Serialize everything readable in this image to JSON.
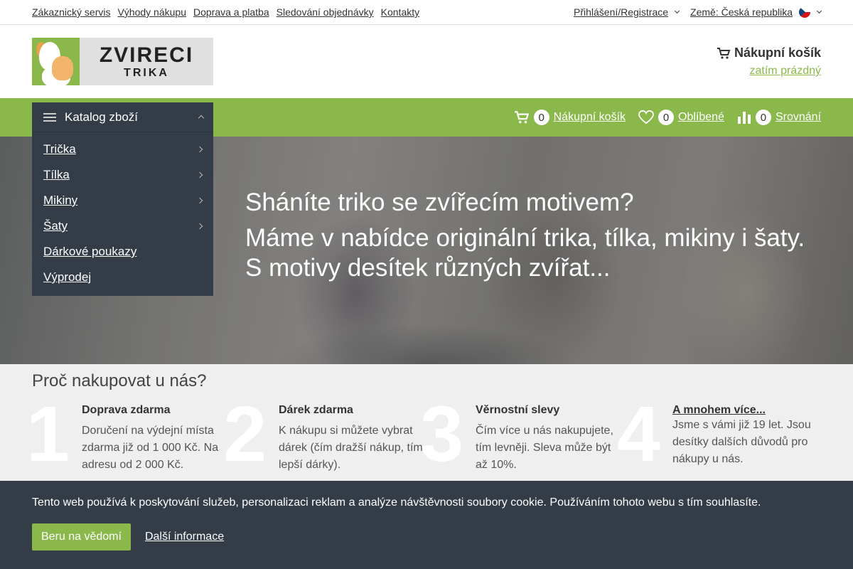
{
  "topbar": {
    "links": [
      "Zákaznický servis",
      "Výhody nákupu",
      "Doprava a platba",
      "Sledování objednávky",
      "Kontakty"
    ],
    "login": "Přihlášení/Registrace",
    "country": "Země: Česká republika"
  },
  "header": {
    "logo_line1": "ZVIRECI",
    "logo_line2": "TRIKA",
    "cart_title": "Nákupní košík",
    "cart_status": "zatím prázdný"
  },
  "nav": {
    "cart_count": "0",
    "cart_label": "Nákupní košík",
    "fav_count": "0",
    "fav_label": "Oblíbené",
    "compare_count": "0",
    "compare_label": "Srovnání"
  },
  "catalog": {
    "title": "Katalog zboží",
    "items": [
      "Trička",
      "Tílka",
      "Mikiny",
      "Šaty",
      "Dárkové poukazy",
      "Výprodej"
    ]
  },
  "hero": {
    "line1": "Sháníte triko se zvířecím motivem?",
    "line2": "Máme v nabídce originální trika, tílka, mikiny i šaty.",
    "line3": "S motivy desítek různých zvířat..."
  },
  "why": {
    "title": "Proč nakupovat u nás?",
    "benefits": [
      {
        "num": "1",
        "title": "Doprava zdarma",
        "text": "Doručení na výdejní místa zdarma již od 1 000 Kč. Na adresu od 2 000 Kč."
      },
      {
        "num": "2",
        "title": "Dárek zdarma",
        "text": "K nákupu si můžete vybrat dárek (čím dražší nákup, tím lepší dárky)."
      },
      {
        "num": "3",
        "title": "Věrnostní slevy",
        "text": "Čím více u nás nakupujete, tím levněji. Sleva může být až 10%."
      },
      {
        "num": "4",
        "title": "A mnohem více...",
        "text": "Jsme s vámi již 19 let. Jsou desítky dalších důvodů pro nákupy u nás."
      }
    ]
  },
  "cookie": {
    "text": "Tento web používá k poskytování služeb, personalizaci reklam a analýze návštěvnosti soubory cookie. Používáním tohoto webu s tím souhlasíte.",
    "accept": "Beru na vědomí",
    "more": "Další informace"
  },
  "colors": {
    "accent": "#8ab84a",
    "dark": "#343d47"
  },
  "icons": [
    "cart-icon",
    "heart-icon",
    "chart-icon",
    "menu-icon",
    "chevron-down-icon",
    "chevron-right-icon",
    "chevron-up-icon",
    "flag-cz-icon"
  ]
}
